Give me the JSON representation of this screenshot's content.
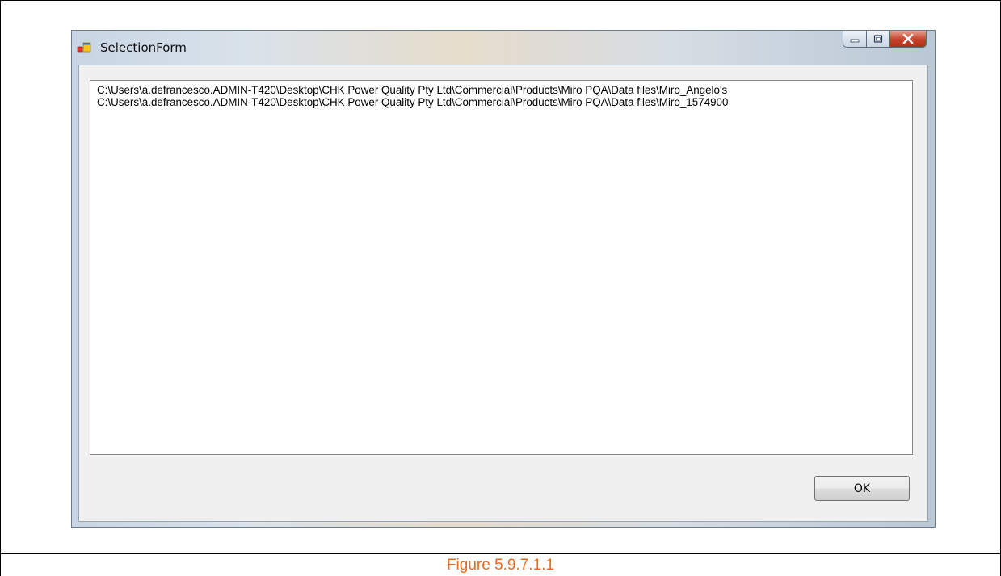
{
  "window": {
    "title": "SelectionForm",
    "controls": [
      "minimize-icon",
      "maximize-icon",
      "close-icon"
    ]
  },
  "listbox": {
    "items": [
      "C:\\Users\\a.defrancesco.ADMIN-T420\\Desktop\\CHK Power Quality Pty Ltd\\Commercial\\Products\\Miro PQA\\Data files\\Miro_Angelo's",
      "C:\\Users\\a.defrancesco.ADMIN-T420\\Desktop\\CHK Power Quality Pty Ltd\\Commercial\\Products\\Miro PQA\\Data files\\Miro_1574900"
    ]
  },
  "ok_button": {
    "label": "OK"
  },
  "caption": "Figure 5.9.7.1.1",
  "colors": {
    "caption": "#ea6a1e",
    "close_button": "#c4412a",
    "client_bg": "#f0f0f0"
  }
}
